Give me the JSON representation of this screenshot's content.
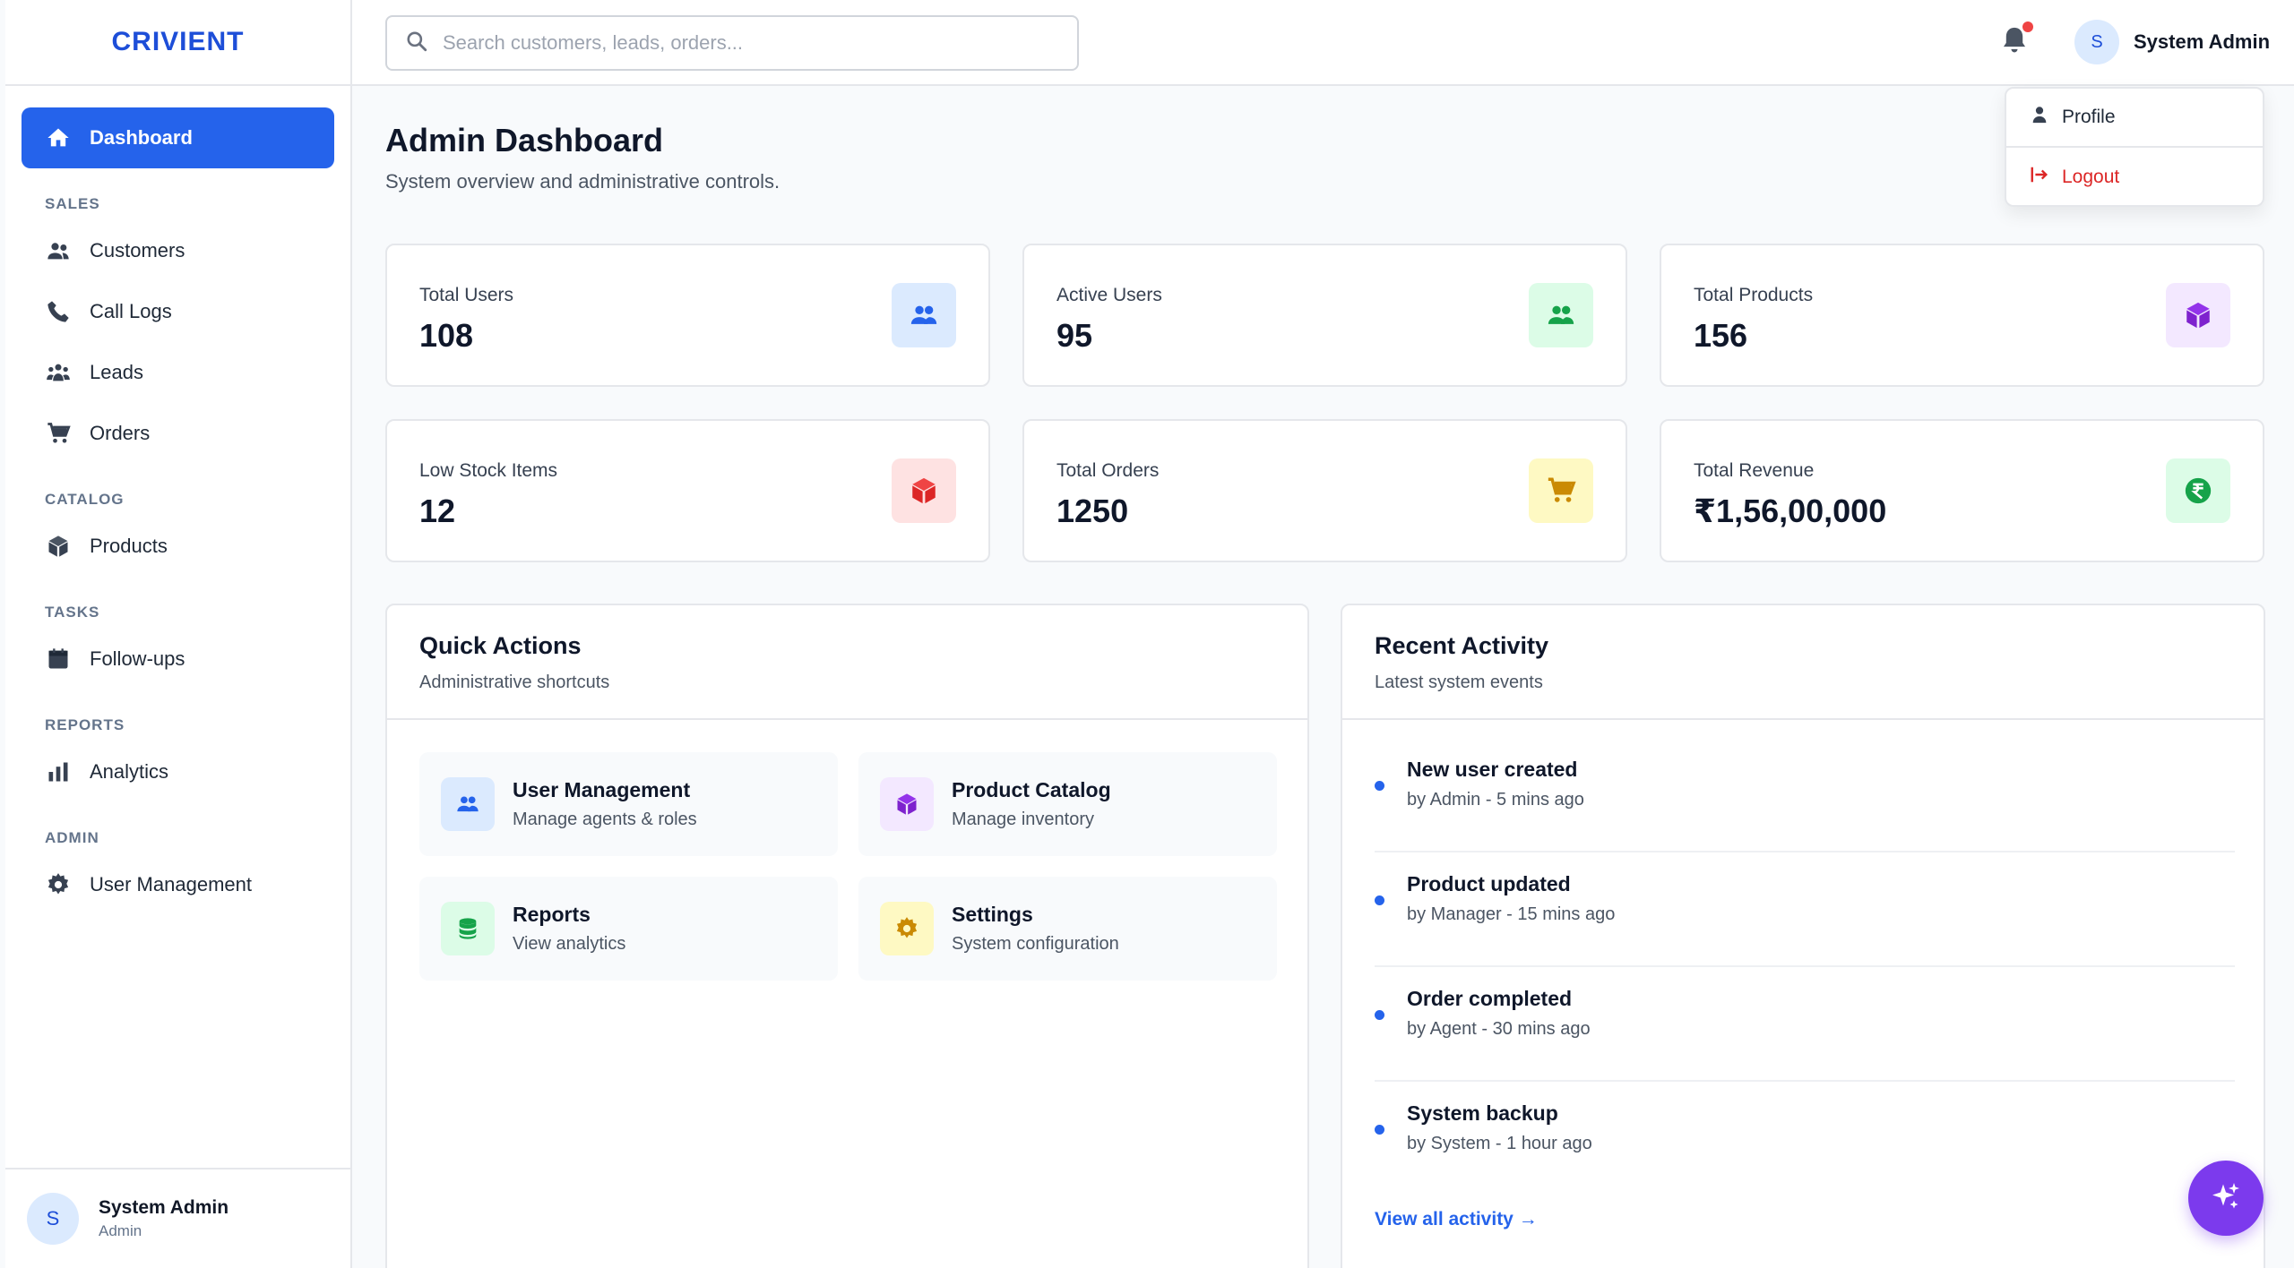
{
  "brand": "CRIVIENT",
  "search": {
    "placeholder": "Search customers, leads, orders..."
  },
  "header": {
    "user_name": "System Admin",
    "user_initial": "S"
  },
  "dropdown": {
    "profile": "Profile",
    "logout": "Logout"
  },
  "sidebar": {
    "dashboard": "Dashboard",
    "sections": {
      "sales": "SALES",
      "catalog": "CATALOG",
      "tasks": "TASKS",
      "reports": "REPORTS",
      "admin": "ADMIN"
    },
    "items": {
      "customers": "Customers",
      "call_logs": "Call Logs",
      "leads": "Leads",
      "orders": "Orders",
      "products": "Products",
      "followups": "Follow-ups",
      "analytics": "Analytics",
      "user_management": "User Management"
    },
    "user": {
      "name": "System Admin",
      "role": "Admin",
      "initial": "S"
    }
  },
  "page": {
    "title": "Admin Dashboard",
    "subtitle": "System overview and administrative controls."
  },
  "stats": [
    {
      "label": "Total Users",
      "value": "108"
    },
    {
      "label": "Active Users",
      "value": "95"
    },
    {
      "label": "Total Products",
      "value": "156"
    },
    {
      "label": "Low Stock Items",
      "value": "12"
    },
    {
      "label": "Total Orders",
      "value": "1250"
    },
    {
      "label": "Total Revenue",
      "value": "₹1,56,00,000"
    }
  ],
  "quick_actions": {
    "title": "Quick Actions",
    "subtitle": "Administrative shortcuts",
    "items": [
      {
        "title": "User Management",
        "desc": "Manage agents & roles"
      },
      {
        "title": "Product Catalog",
        "desc": "Manage inventory"
      },
      {
        "title": "Reports",
        "desc": "View analytics"
      },
      {
        "title": "Settings",
        "desc": "System configuration"
      }
    ]
  },
  "recent_activity": {
    "title": "Recent Activity",
    "subtitle": "Latest system events",
    "items": [
      {
        "title": "New user created",
        "meta": "by Admin - 5 mins ago"
      },
      {
        "title": "Product updated",
        "meta": "by Manager - 15 mins ago"
      },
      {
        "title": "Order completed",
        "meta": "by Agent - 30 mins ago"
      },
      {
        "title": "System backup",
        "meta": "by System - 1 hour ago"
      }
    ],
    "view_all": "View all activity →"
  },
  "colors": {
    "accent": "#2563eb",
    "brand": "#1d4ed8",
    "danger": "#dc2626",
    "fab": "#7c3aed"
  }
}
